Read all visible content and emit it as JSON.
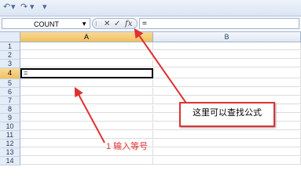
{
  "toolbar": {
    "undo_icon": "undo-icon",
    "redo_icon": "redo-icon",
    "customize": "▾"
  },
  "formula_bar": {
    "name_box_value": "COUNT",
    "cancel_symbol": "✕",
    "enter_symbol": "✓",
    "fx_symbol": "fx",
    "formula_value": "="
  },
  "sheet": {
    "columns": [
      "A",
      "B"
    ],
    "rows": [
      "1",
      "2",
      "3",
      "4",
      "5",
      "6",
      "7",
      "8",
      "9",
      "10",
      "11",
      "12",
      "13",
      "14"
    ],
    "active_cell_value": "="
  },
  "annotations": {
    "callout_text": "这里可以查找公式",
    "step_text": "1 输入等号",
    "accent_color": "#e03030"
  }
}
